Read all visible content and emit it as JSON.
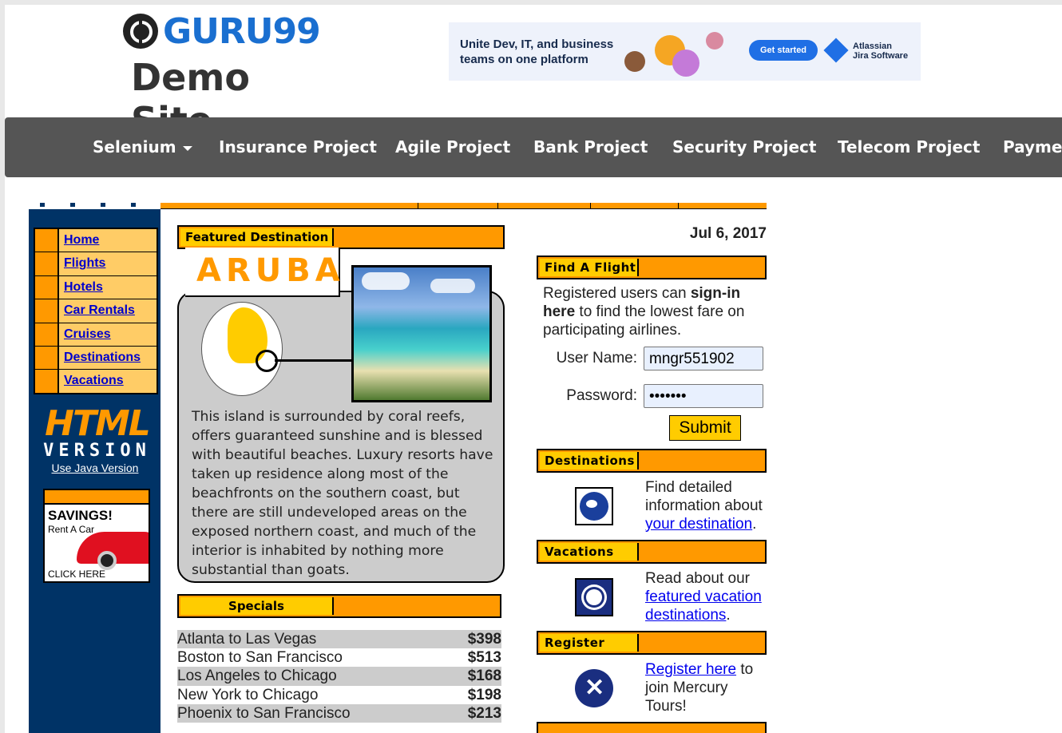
{
  "header": {
    "logo_text": "GURU99",
    "logo_subtitle": "Demo Site"
  },
  "ad": {
    "headline": "Unite Dev, IT, and business teams on one platform",
    "cta": "Get started",
    "brand_line1": "Atlassian",
    "brand_line2": "Jira Software"
  },
  "nav": {
    "items": [
      {
        "label": "Selenium"
      },
      {
        "label": "Insurance Project"
      },
      {
        "label": "Agile Project"
      },
      {
        "label": "Bank Project"
      },
      {
        "label": "Security Project"
      },
      {
        "label": "Telecom Project"
      },
      {
        "label": "Paymen"
      }
    ]
  },
  "sidebar": {
    "menu": [
      "Home",
      "Flights",
      "Hotels",
      "Car Rentals",
      "Cruises",
      "Destinations",
      "Vacations"
    ],
    "html_big": "HTML",
    "html_small": "VERSION",
    "java_link": "Use Java Version",
    "savings_title": "SAVINGS!",
    "savings_sub": "Rent A Car",
    "savings_click": "CLICK HERE"
  },
  "featured": {
    "tab": "Featured Destination",
    "name": "ARUBA",
    "description": "This island is surrounded by coral reefs, offers guaranteed sunshine and is blessed with beautiful beaches. Luxury resorts have taken up residence along most of the beachfronts on the southern coast, but there are still undeveloped areas on the exposed northern coast, and much of the interior is inhabited by nothing more substantial than goats."
  },
  "specials": {
    "tab": "Specials",
    "rows": [
      {
        "route": "Atlanta to Las Vegas",
        "price": "$398"
      },
      {
        "route": "Boston to San Francisco",
        "price": "$513"
      },
      {
        "route": "Los Angeles to Chicago",
        "price": "$168"
      },
      {
        "route": "New York to Chicago",
        "price": "$198"
      },
      {
        "route": "Phoenix to San Francisco",
        "price": "$213"
      }
    ]
  },
  "right": {
    "date": "Jul 6, 2017",
    "find_flight_tab": "Find A Flight",
    "signin_pre": "Registered users can ",
    "signin_bold": "sign-in here",
    "signin_post": " to find the lowest fare on participating airlines.",
    "username_label": "User Name:",
    "username_value": "mngr551902",
    "password_label": "Password:",
    "password_value": "•••••••",
    "submit_label": "Submit",
    "destinations_tab": "Destinations",
    "dest_text": "Find detailed information about ",
    "dest_link": "your destination",
    "dest_end": ".",
    "vacations_tab": "Vacations",
    "vac_text": "Read about our ",
    "vac_link": "featured vacation destinations",
    "vac_end": ".",
    "register_tab": "Register",
    "reg_link": "Register here",
    "reg_text": " to join Mercury Tours!"
  }
}
